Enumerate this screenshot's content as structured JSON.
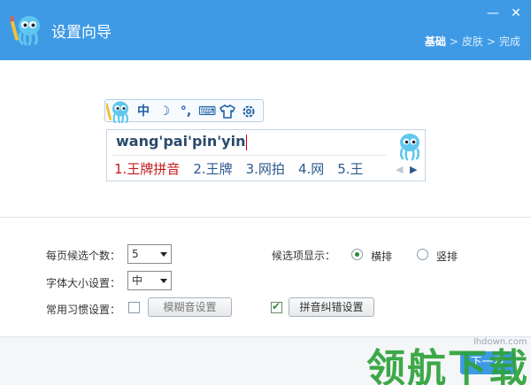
{
  "window": {
    "title": "设置向导",
    "minimize_glyph": "—",
    "close_glyph": "✕"
  },
  "steps": {
    "items": [
      "基础",
      "皮肤",
      "完成"
    ],
    "separator": ">",
    "active_index": 0
  },
  "toolbar": {
    "items": [
      {
        "icon": "chinese-mode-icon",
        "label": "中"
      },
      {
        "icon": "moon-icon",
        "label": "☽"
      },
      {
        "icon": "punctuation-icon",
        "label": "°,"
      },
      {
        "icon": "keyboard-icon",
        "label": "⌨"
      },
      {
        "icon": "skin-shirt-icon",
        "label": "👕"
      },
      {
        "icon": "gear-icon",
        "label": "⚙"
      }
    ]
  },
  "candidate": {
    "input": "wang'pai'pin'yin",
    "items": [
      "1.王牌拼音",
      "2.王牌",
      "3.网拍",
      "4.网",
      "5.王"
    ]
  },
  "settings": {
    "per_page_label": "每页候选个数：",
    "per_page_value": "5",
    "font_size_label": "字体大小设置：",
    "font_size_value": "中",
    "habit_label": "常用习惯设置：",
    "fuzzy_button": "模糊音设置",
    "fuzzy_checked": false,
    "correction_button": "拼音纠错设置",
    "correction_checked": true,
    "display_label": "候选项显示：",
    "horizontal_label": "横排",
    "vertical_label": "竖排",
    "display_value": "横排"
  },
  "footer": {
    "next_button": "下一步"
  },
  "watermark": {
    "site": "lhdown.com",
    "text": "领航下载"
  },
  "colors": {
    "header_bg": "#3f9ae6",
    "candidate_first": "#c41b1b",
    "accent_green": "#2ea23a"
  }
}
